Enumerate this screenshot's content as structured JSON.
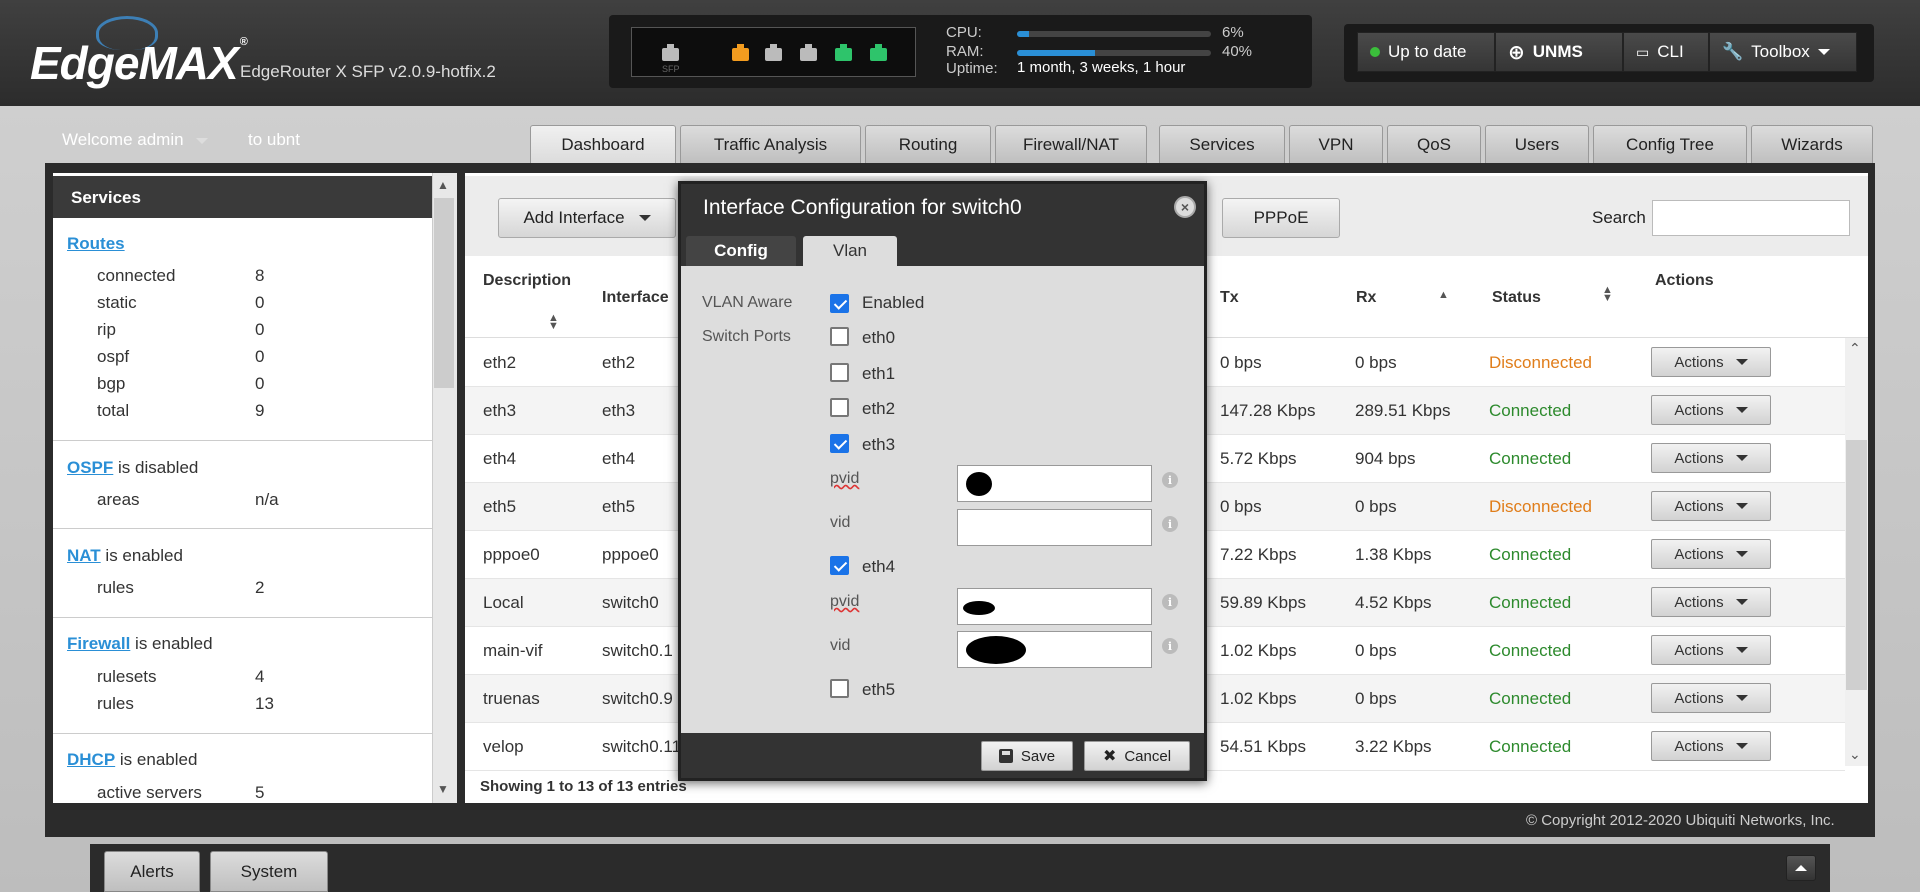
{
  "header": {
    "logo": "EdgeMAX",
    "logo_tm": "®",
    "device": "EdgeRouter X SFP v2.0.9-hotfix.2",
    "sfp_label": "SFP",
    "stats": {
      "cpu_label": "CPU:",
      "cpu_pct": "6%",
      "cpu_value": 6,
      "ram_label": "RAM:",
      "ram_pct": "40%",
      "ram_value": 40,
      "uptime_label": "Uptime:",
      "uptime": "1 month, 3 weeks, 1 hour"
    },
    "port_colors": [
      "#bbbbbb",
      "#f39c1f",
      "#bbbbbb",
      "#bbbbbb",
      "#2ec46b",
      "#2ec46b"
    ],
    "buttons": {
      "status": "Up to date",
      "unms": "UNMS",
      "cli": "CLI",
      "toolbox": "Toolbox"
    }
  },
  "user": {
    "welcome": "Welcome admin",
    "to": "to ubnt"
  },
  "tabs": [
    "Dashboard",
    "Traffic Analysis",
    "Routing",
    "Firewall/NAT",
    "Services",
    "VPN",
    "QoS",
    "Users",
    "Config Tree",
    "Wizards"
  ],
  "sidebar": {
    "title": "Services",
    "routes": {
      "link": "Routes",
      "rows": [
        [
          "connected",
          "8"
        ],
        [
          "static",
          "0"
        ],
        [
          "rip",
          "0"
        ],
        [
          "ospf",
          "0"
        ],
        [
          "bgp",
          "0"
        ],
        [
          "total",
          "9"
        ]
      ]
    },
    "ospf": {
      "link": "OSPF",
      "status": "is disabled",
      "rows": [
        [
          "areas",
          "n/a"
        ]
      ]
    },
    "nat": {
      "link": "NAT",
      "status": "is enabled",
      "rows": [
        [
          "rules",
          "2"
        ]
      ]
    },
    "firewall": {
      "link": "Firewall",
      "status": "is enabled",
      "rows": [
        [
          "rulesets",
          "4"
        ],
        [
          "rules",
          "13"
        ]
      ]
    },
    "dhcp": {
      "link": "DHCP",
      "status": "is enabled",
      "rows": [
        [
          "active servers",
          "5"
        ]
      ]
    }
  },
  "main": {
    "add_interface": "Add Interface",
    "pppoe": "PPPoE",
    "search_label": "Search",
    "columns": {
      "description": "Description",
      "interface": "Interface",
      "tx": "Tx",
      "rx": "Rx",
      "status": "Status",
      "actions": "Actions"
    },
    "rows": [
      {
        "desc": "eth2",
        "iface": "eth2",
        "tx": "0 bps",
        "rx": "0 bps",
        "status": "Disconnected",
        "action": "Actions"
      },
      {
        "desc": "eth3",
        "iface": "eth3",
        "tx": "147.28 Kbps",
        "rx": "289.51 Kbps",
        "status": "Connected",
        "action": "Actions"
      },
      {
        "desc": "eth4",
        "iface": "eth4",
        "tx": "5.72 Kbps",
        "rx": "904 bps",
        "status": "Connected",
        "action": "Actions"
      },
      {
        "desc": "eth5",
        "iface": "eth5",
        "tx": "0 bps",
        "rx": "0 bps",
        "status": "Disconnected",
        "action": "Actions"
      },
      {
        "desc": "pppoe0",
        "iface": "pppoe0",
        "tx": "7.22 Kbps",
        "rx": "1.38 Kbps",
        "status": "Connected",
        "action": "Actions"
      },
      {
        "desc": "Local",
        "iface": "switch0",
        "tx": "59.89 Kbps",
        "rx": "4.52 Kbps",
        "status": "Connected",
        "action": "Actions"
      },
      {
        "desc": "main-vif",
        "iface": "switch0.1",
        "tx": "1.02 Kbps",
        "rx": "0 bps",
        "status": "Connected",
        "action": "Actions"
      },
      {
        "desc": "truenas",
        "iface": "switch0.9",
        "tx": "1.02 Kbps",
        "rx": "0 bps",
        "status": "Connected",
        "action": "Actions"
      },
      {
        "desc": "velop",
        "iface": "switch0.11",
        "tx": "54.51 Kbps",
        "rx": "3.22 Kbps",
        "status": "Connected",
        "action": "Actions"
      }
    ],
    "footer": "Showing 1 to 13 of 13 entries"
  },
  "modal": {
    "title": "Interface Configuration for switch0",
    "tabs": [
      "Config",
      "Vlan"
    ],
    "vlan_aware_label": "VLAN Aware",
    "vlan_aware_value": "Enabled",
    "switch_ports_label": "Switch Ports",
    "ports": [
      "eth0",
      "eth1",
      "eth2",
      "eth3",
      "eth4",
      "eth5"
    ],
    "pvid_label": "pvid",
    "vid_label": "vid",
    "info_glyph": "i",
    "close_glyph": "×",
    "save": "Save",
    "cancel": "Cancel"
  },
  "copyright": "© Copyright 2012-2020 Ubiquiti Networks, Inc.",
  "bottom_tabs": [
    "Alerts",
    "System"
  ]
}
